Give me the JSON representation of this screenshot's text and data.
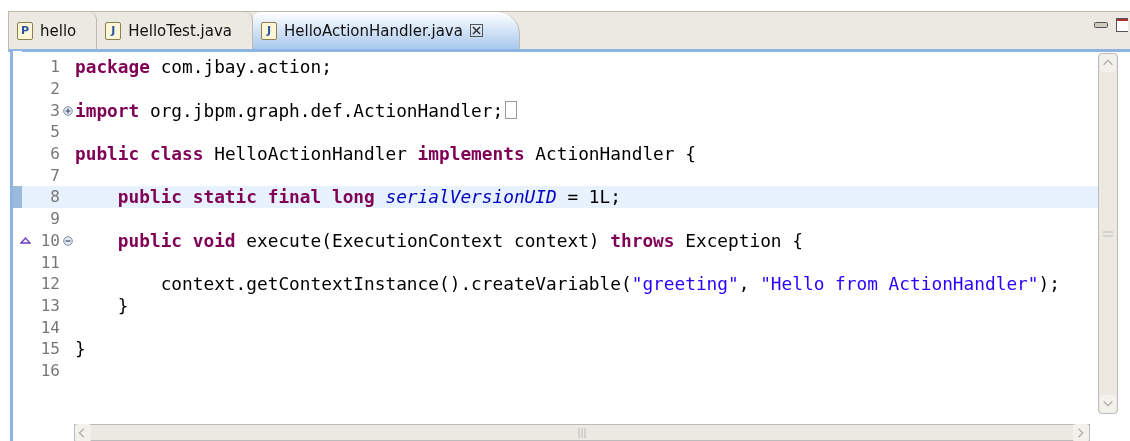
{
  "tabs": [
    {
      "label": "hello",
      "icon_letter": "P",
      "selected": false,
      "closable": false
    },
    {
      "label": "HelloTest.java",
      "icon_letter": "J",
      "selected": false,
      "closable": false
    },
    {
      "label": "HelloActionHandler.java",
      "icon_letter": "J",
      "selected": true,
      "closable": true
    }
  ],
  "editor": {
    "lines": [
      {
        "number": "1",
        "tokens": [
          {
            "kind": "keyword",
            "text": "package"
          },
          {
            "kind": "plain",
            "text": " com.jbay.action;"
          }
        ]
      },
      {
        "number": "2"
      },
      {
        "number": "3",
        "fold_collapsed": true,
        "tokens": [
          {
            "kind": "keyword",
            "text": "import"
          },
          {
            "kind": "plain",
            "text": " org.jbpm.graph.def.ActionHandler;"
          }
        ]
      },
      {
        "number": "5"
      },
      {
        "number": "6",
        "tokens": [
          {
            "kind": "keyword",
            "text": "public class"
          },
          {
            "kind": "plain",
            "text": " HelloActionHandler "
          },
          {
            "kind": "keyword",
            "text": "implements"
          },
          {
            "kind": "plain",
            "text": " ActionHandler {"
          }
        ]
      },
      {
        "number": "7"
      },
      {
        "number": "8",
        "current": true,
        "tokens": [
          {
            "kind": "keyword",
            "text": "    public static final long "
          },
          {
            "kind": "field",
            "text": "serialVersionUID"
          },
          {
            "kind": "plain",
            "text": " = 1L;"
          }
        ]
      },
      {
        "number": "9"
      },
      {
        "number": "10",
        "fold_collapsed": false,
        "override": true,
        "tokens": [
          {
            "kind": "keyword",
            "text": "    public void"
          },
          {
            "kind": "plain",
            "text": " execute(ExecutionContext context) "
          },
          {
            "kind": "keyword",
            "text": "throws"
          },
          {
            "kind": "plain",
            "text": " Exception {"
          }
        ]
      },
      {
        "number": "11"
      },
      {
        "number": "12",
        "tokens": [
          {
            "kind": "plain",
            "text": "        context.getContextInstance().createVariable("
          },
          {
            "kind": "string",
            "text": "\"greeting\""
          },
          {
            "kind": "plain",
            "text": ", "
          },
          {
            "kind": "string",
            "text": "\"Hello from ActionHandler\""
          },
          {
            "kind": "plain",
            "text": ");"
          }
        ]
      },
      {
        "number": "13",
        "tokens": [
          {
            "kind": "plain",
            "text": "    }"
          }
        ]
      },
      {
        "number": "14"
      },
      {
        "number": "15",
        "tokens": [
          {
            "kind": "plain",
            "text": "}"
          }
        ]
      },
      {
        "number": "16"
      }
    ]
  }
}
